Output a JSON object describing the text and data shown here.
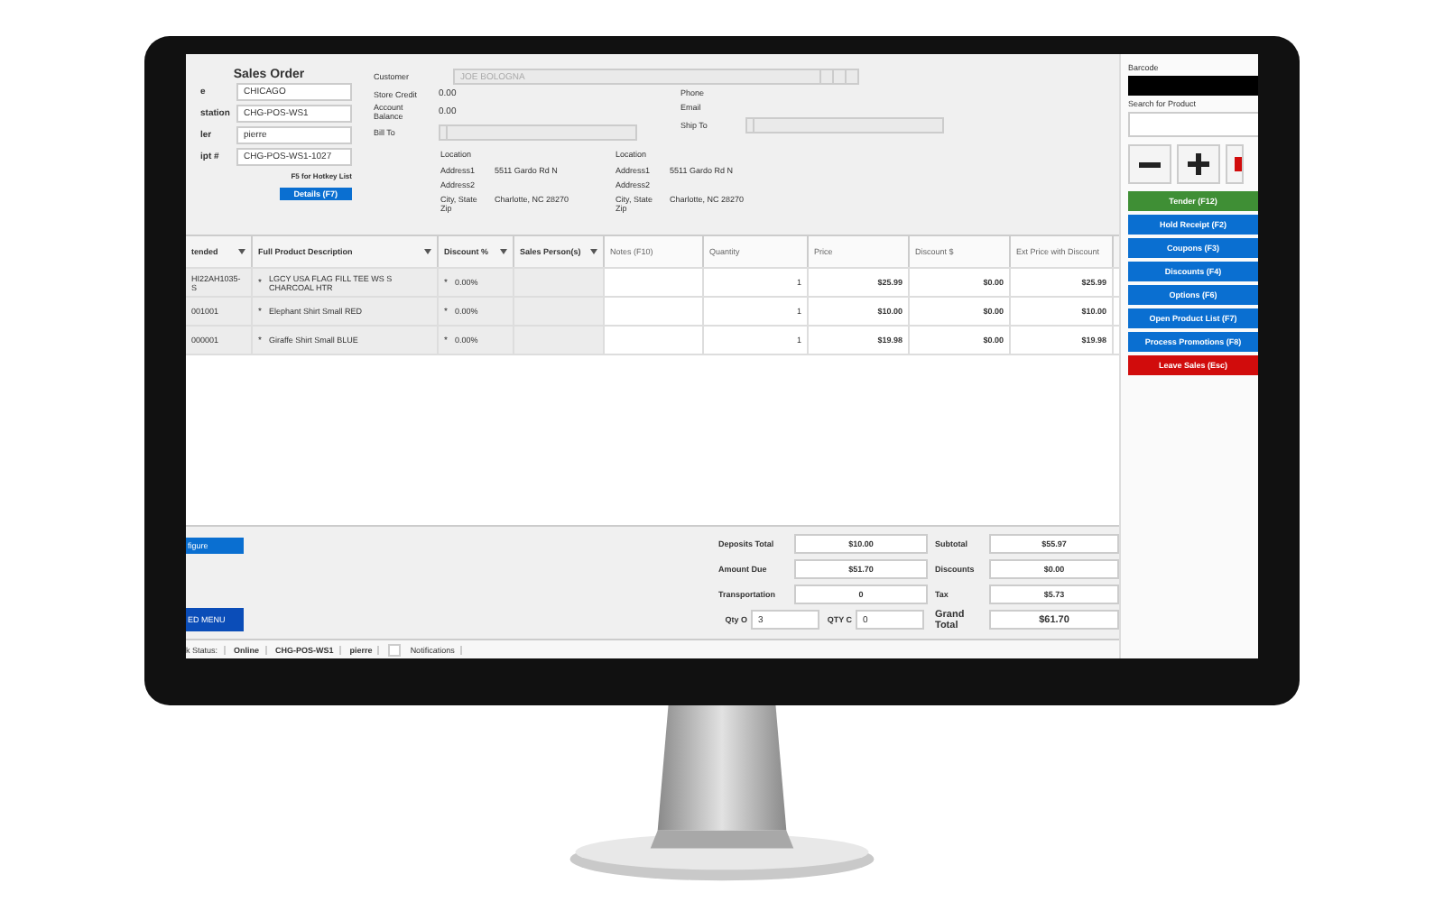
{
  "order": {
    "title": "Sales Order",
    "fields": [
      {
        "label": "e",
        "value": "CHICAGO"
      },
      {
        "label": "station",
        "value": "CHG-POS-WS1"
      },
      {
        "label": "ler",
        "value": "pierre"
      },
      {
        "label": "ipt #",
        "value": "CHG-POS-WS1-1027"
      }
    ],
    "hotkey_hint": "F5 for Hotkey List",
    "details_button": "Details (F7)"
  },
  "customer": {
    "label": "Customer",
    "value": "JOE BOLOGNA",
    "disabled": true,
    "info": [
      {
        "label": "Store Credit",
        "value": "0.00"
      },
      {
        "label": "Account Balance",
        "value": "0.00"
      }
    ],
    "contact": [
      "Phone",
      "Email"
    ],
    "bill_to": "Bill To",
    "ship_to": "Ship To",
    "locations": [
      {
        "heading": "Location",
        "lines": [
          {
            "label": "Address1",
            "value": "5511 Gardo Rd N"
          },
          {
            "label": "Address2"
          },
          {
            "label": "City, State Zip",
            "value": "Charlotte, NC 28270"
          }
        ]
      },
      {
        "heading": "Location",
        "lines": [
          {
            "label": "Address1",
            "value": "5511 Gardo Rd N"
          },
          {
            "label": "Address2"
          },
          {
            "label": "City, State Zip",
            "value": "Charlotte, NC 28270"
          }
        ]
      }
    ]
  },
  "table": {
    "columns": [
      {
        "label": "tended",
        "caret": true,
        "kind": "text"
      },
      {
        "label": "Full Product Description",
        "caret": true,
        "kind": "text"
      },
      {
        "label": "Discount %",
        "caret": true,
        "kind": "text"
      },
      {
        "label": "Sales Person(s)",
        "caret": true,
        "kind": "text"
      },
      {
        "label": "Notes (F10)",
        "caret": false,
        "kind": "text"
      },
      {
        "label": "Quantity",
        "caret": false,
        "kind": "number"
      },
      {
        "label": "Price",
        "caret": false,
        "kind": "money"
      },
      {
        "label": "Discount $",
        "caret": false,
        "kind": "money"
      },
      {
        "label": "Ext Price with Discount",
        "caret": false,
        "kind": "money"
      }
    ],
    "rows": [
      [
        {
          "text": "HI22AH1035-S"
        },
        {
          "mark": "*",
          "text": "LGCY USA FLAG FILL TEE WS S CHARCOAL HTR"
        },
        {
          "mark": "*",
          "text": "0.00%"
        },
        {},
        {},
        {
          "text": "1"
        },
        {
          "text": "$25.99"
        },
        {
          "text": "$0.00"
        },
        {
          "text": "$25.99"
        }
      ],
      [
        {
          "text": "001001"
        },
        {
          "mark": "*",
          "text": "Elephant Shirt Small RED"
        },
        {
          "mark": "*",
          "text": "0.00%"
        },
        {},
        {},
        {
          "text": "1"
        },
        {
          "text": "$10.00"
        },
        {
          "text": "$0.00"
        },
        {
          "text": "$10.00"
        }
      ],
      [
        {
          "text": "000001"
        },
        {
          "mark": "*",
          "text": "Giraffe Shirt Small BLUE"
        },
        {
          "mark": "*",
          "text": "0.00%"
        },
        {},
        {},
        {
          "text": "1"
        },
        {
          "text": "$19.98"
        },
        {
          "text": "$0.00"
        },
        {
          "text": "$19.98"
        }
      ]
    ]
  },
  "left_buttons": [
    "figure",
    "ED MENU"
  ],
  "totals": {
    "left": [
      {
        "label": "Deposits Total",
        "value": "$10.00"
      },
      {
        "label": "Amount Due",
        "value": "$51.70"
      },
      {
        "label": "Transportation",
        "value": "0"
      }
    ],
    "right": [
      {
        "label": "Subtotal",
        "value": "$55.97"
      },
      {
        "label": "Discounts",
        "value": "$0.00"
      },
      {
        "label": "Tax",
        "value": "$5.73"
      },
      {
        "label": "Grand Total",
        "value": "$61.70"
      }
    ],
    "qty": [
      {
        "label": "Qty O",
        "value": "3"
      },
      {
        "label": "QTY C",
        "value": "0"
      }
    ]
  },
  "status_bar": {
    "items": [
      {
        "text": "k Status:",
        "bold": false
      },
      {
        "text": "Online",
        "bold": true
      },
      {
        "text": "CHG-POS-WS1",
        "bold": true
      },
      {
        "text": "pierre",
        "bold": true
      }
    ],
    "notifications": {
      "label": "Notifications",
      "checked": false
    }
  },
  "side": {
    "barcode_label": "Barcode",
    "search_label": "Search for Product",
    "actions": [
      {
        "label": "Tender (F12)",
        "color": "#3f8f35"
      },
      {
        "label": "Hold Receipt (F2)",
        "color": "#0a6fd1"
      },
      {
        "label": "Coupons (F3)",
        "color": "#0a6fd1"
      },
      {
        "label": "Discounts (F4)",
        "color": "#0a6fd1"
      },
      {
        "label": "Options (F6)",
        "color": "#0a6fd1"
      },
      {
        "label": "Open Product List (F7)",
        "color": "#0a6fd1"
      },
      {
        "label": "Process Promotions (F8)",
        "color": "#0a6fd1"
      },
      {
        "label": "Leave Sales (Esc)",
        "color": "#d10c0c"
      }
    ]
  }
}
